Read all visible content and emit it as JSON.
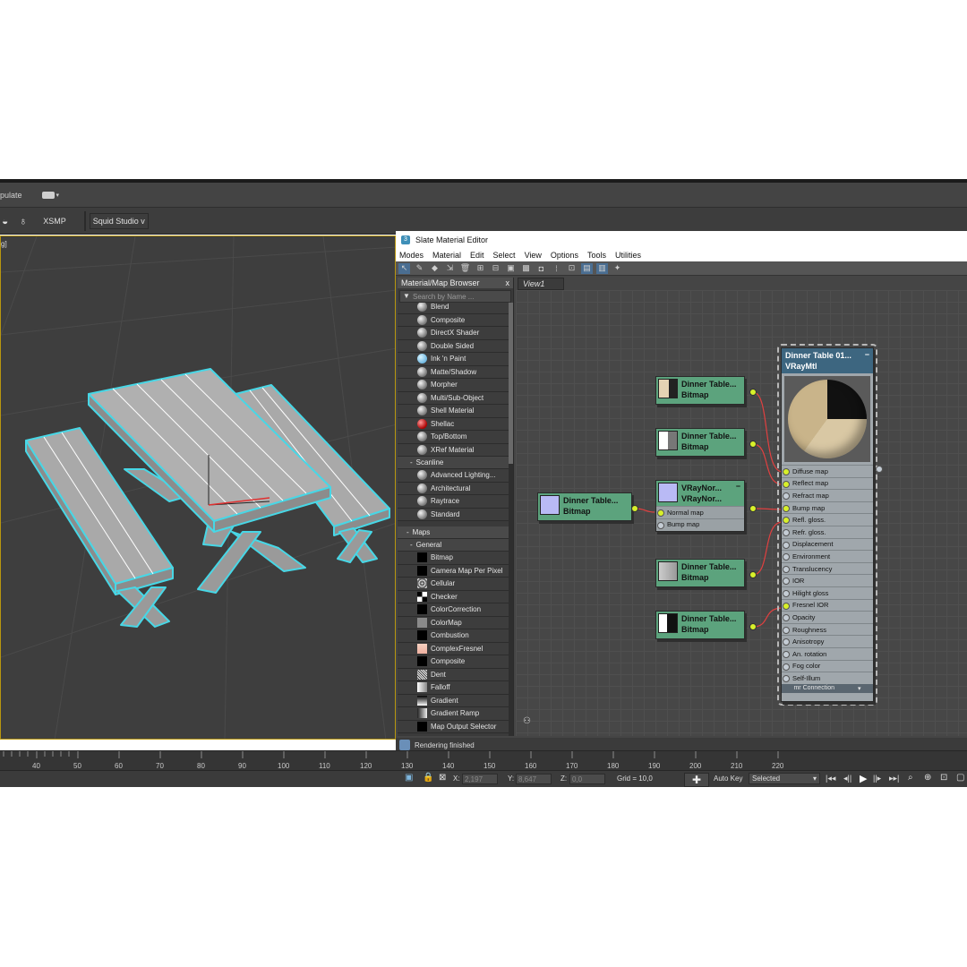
{
  "app": {
    "menu_fragment": "pulate",
    "toolbar_items": [
      "XSMP",
      "Squid Studio v"
    ],
    "viewport_label": "g]"
  },
  "sme": {
    "title": "Slate Material Editor",
    "menu": [
      "Modes",
      "Material",
      "Edit",
      "Select",
      "View",
      "Options",
      "Tools",
      "Utilities"
    ],
    "view_tab": "View1",
    "status": "Rendering finished"
  },
  "browser": {
    "title": "Material/Map Browser",
    "close": "x",
    "search_placeholder": "Search by Name ...",
    "materials": [
      "Blend",
      "Composite",
      "DirectX Shader",
      "Double Sided",
      "Ink 'n Paint",
      "Matte/Shadow",
      "Morpher",
      "Multi/Sub-Object",
      "Shell Material",
      "Shellac",
      "Top/Bottom",
      "XRef Material"
    ],
    "scanline_title": "Scanline",
    "scanline": [
      "Advanced Lighting...",
      "Architectural",
      "Raytrace",
      "Standard"
    ],
    "maps_title": "Maps",
    "general_title": "General",
    "maps": [
      "Bitmap",
      "Camera Map Per Pixel",
      "Cellular",
      "Checker",
      "ColorCorrection",
      "ColorMap",
      "Combustion",
      "ComplexFresnel",
      "Composite",
      "Dent",
      "Falloff",
      "Gradient",
      "Gradient Ramp",
      "Map Output Selector"
    ]
  },
  "nodes": {
    "bitmap1": {
      "line1": "Dinner Table...",
      "line2": "Bitmap"
    },
    "bitmap2": {
      "line1": "Dinner Table...",
      "line2": "Bitmap"
    },
    "bitmap_left": {
      "line1": "Dinner Table...",
      "line2": "Bitmap"
    },
    "normal": {
      "line1": "VRayNor...",
      "line2": "VRayNor...",
      "slots": [
        "Normal map",
        "Bump map"
      ]
    },
    "bitmap3": {
      "line1": "Dinner Table...",
      "line2": "Bitmap"
    },
    "bitmap4": {
      "line1": "Dinner Table...",
      "line2": "Bitmap"
    },
    "vray": {
      "title": "Dinner Table 01...",
      "subtitle": "VRayMtl",
      "slots": [
        "Diffuse map",
        "Reflect map",
        "Refract map",
        "Bump map",
        "Refl. gloss.",
        "Refr. gloss.",
        "Displacement",
        "Environment",
        "Translucency",
        "IOR",
        "Hilight gloss",
        "Fresnel IOR",
        "Opacity",
        "Roughness",
        "Anisotropy",
        "An. rotation",
        "Fog color",
        "Self-Illum"
      ],
      "footer": "mr Connection"
    }
  },
  "timeline": {
    "ticks": [
      "40",
      "50",
      "60",
      "70",
      "80",
      "90",
      "100",
      "110",
      "120",
      "130",
      "140",
      "150",
      "160",
      "170",
      "180",
      "190",
      "200",
      "210",
      "220"
    ]
  },
  "statusbar": {
    "x_label": "X:",
    "x_value": "2,197",
    "y_label": "Y:",
    "y_value": "8,647",
    "z_label": "Z:",
    "z_value": "0,0",
    "grid": "Grid = 10,0",
    "auto_key": "Auto Key",
    "selected": "Selected"
  },
  "colors": {
    "node_header": "#5ca37d",
    "port_active": "#d8f02a",
    "wire": "#e04040",
    "selection_outline": "#47d7e6"
  }
}
